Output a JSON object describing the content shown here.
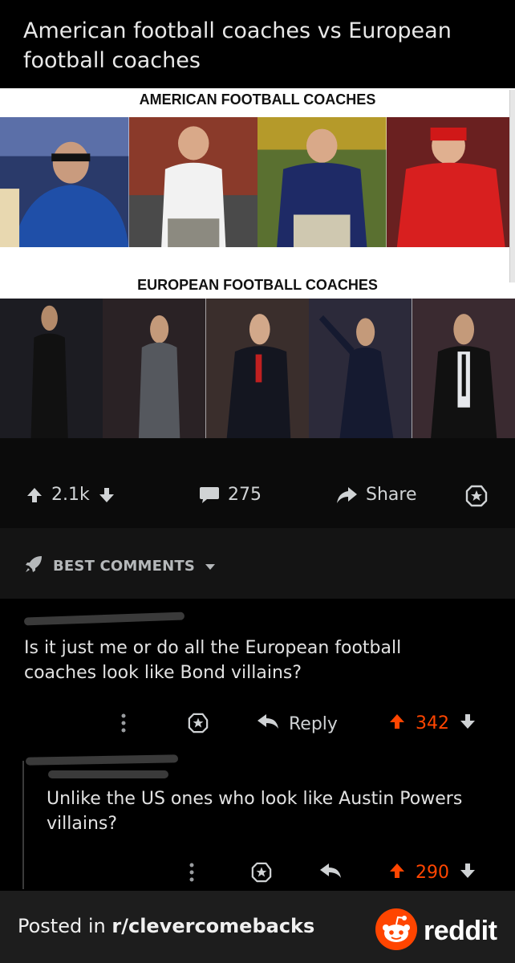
{
  "post": {
    "title": "American football coaches vs European football coaches",
    "image": {
      "heading_american": "AMERICAN FOOTBALL COACHES",
      "heading_european": "EUROPEAN FOOTBALL COACHES"
    }
  },
  "actions": {
    "upvotes": "2.1k",
    "comments": "275",
    "share_label": "Share"
  },
  "sort": {
    "label": "BEST COMMENTS"
  },
  "comments": [
    {
      "text": "Is it just me or do all the European football coaches look like Bond villains?",
      "reply_label": "Reply",
      "score": "342"
    },
    {
      "text": "Unlike the US ones who look like Austin Powers villains?",
      "score": "290"
    }
  ],
  "footer": {
    "posted_in": "Posted in ",
    "subreddit": "r/clevercomebacks",
    "brand": "reddit"
  },
  "colors": {
    "upvote_active": "#ff4500",
    "background": "#000000"
  },
  "icons": {
    "upvote": "arrow-up-icon",
    "downvote": "arrow-down-icon",
    "comments": "speech-bubble-icon",
    "share": "share-arrow-icon",
    "save": "star-icon",
    "sort": "rocket-icon",
    "dropdown": "caret-down-icon",
    "more": "vertical-dots-icon",
    "reply": "reply-arrow-icon",
    "brand": "reddit-alien-icon"
  }
}
